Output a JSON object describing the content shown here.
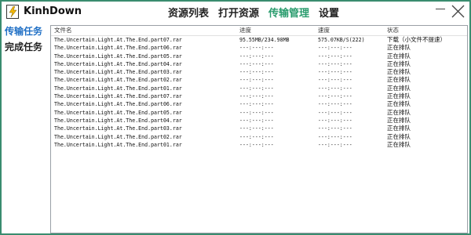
{
  "app": {
    "name": "KinhDown"
  },
  "menu": [
    {
      "label": "资源列表",
      "active": false
    },
    {
      "label": "打开资源",
      "active": false
    },
    {
      "label": "传输管理",
      "active": true
    },
    {
      "label": "设置",
      "active": false
    }
  ],
  "sidebar": [
    {
      "label": "传输任务",
      "active": true
    },
    {
      "label": "完成任务",
      "active": false
    }
  ],
  "table": {
    "headers": {
      "name": "文件名",
      "progress": "进度",
      "speed": "速度",
      "status": "状态"
    },
    "rows": [
      {
        "name": "The.Uncertain.Light.At.The.End.part07.rar",
        "progress": "95.55MB/234.98MB",
        "speed": "575.07KB/S(222)",
        "status": "下载（小文件不提速）"
      },
      {
        "name": "The.Uncertain.Light.At.The.End.part06.rar",
        "progress": "---:---:---",
        "speed": "---:---:---",
        "status": "正在排队"
      },
      {
        "name": "The.Uncertain.Light.At.The.End.part05.rar",
        "progress": "---:---:---",
        "speed": "---:---:---",
        "status": "正在排队"
      },
      {
        "name": "The.Uncertain.Light.At.The.End.part04.rar",
        "progress": "---:---:---",
        "speed": "---:---:---",
        "status": "正在排队"
      },
      {
        "name": "The.Uncertain.Light.At.The.End.part03.rar",
        "progress": "---:---:---",
        "speed": "---:---:---",
        "status": "正在排队"
      },
      {
        "name": "The.Uncertain.Light.At.The.End.part02.rar",
        "progress": "---:---:---",
        "speed": "---:---:---",
        "status": "正在排队"
      },
      {
        "name": "The.Uncertain.Light.At.The.End.part01.rar",
        "progress": "---:---:---",
        "speed": "---:---:---",
        "status": "正在排队"
      },
      {
        "name": "The.Uncertain.Light.At.The.End.part07.rar",
        "progress": "---:---:---",
        "speed": "---:---:---",
        "status": "正在排队"
      },
      {
        "name": "The.Uncertain.Light.At.The.End.part06.rar",
        "progress": "---:---:---",
        "speed": "---:---:---",
        "status": "正在排队"
      },
      {
        "name": "The.Uncertain.Light.At.The.End.part05.rar",
        "progress": "---:---:---",
        "speed": "---:---:---",
        "status": "正在排队"
      },
      {
        "name": "The.Uncertain.Light.At.The.End.part04.rar",
        "progress": "---:---:---",
        "speed": "---:---:---",
        "status": "正在排队"
      },
      {
        "name": "The.Uncertain.Light.At.The.End.part03.rar",
        "progress": "---:---:---",
        "speed": "---:---:---",
        "status": "正在排队"
      },
      {
        "name": "The.Uncertain.Light.At.The.End.part02.rar",
        "progress": "---:---:---",
        "speed": "---:---:---",
        "status": "正在排队"
      },
      {
        "name": "The.Uncertain.Light.At.The.End.part01.rar",
        "progress": "---:---:---",
        "speed": "---:---:---",
        "status": "正在排队"
      }
    ]
  },
  "icons": {
    "logo": "lightning-bolt-icon",
    "minimize": "minimize-icon",
    "close": "close-icon"
  },
  "colors": {
    "window_border": "#3a8c6f",
    "active_menu": "#2a9c6e",
    "active_sidebar": "#1f6fc5"
  }
}
